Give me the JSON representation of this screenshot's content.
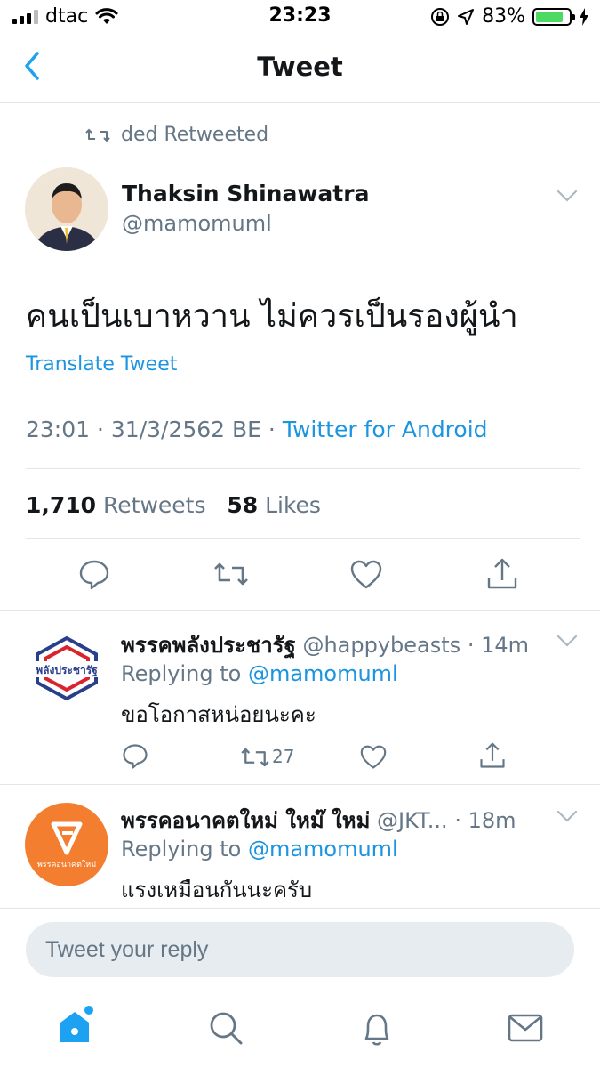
{
  "status_bar": {
    "carrier": "dtac",
    "time": "23:23",
    "battery": "83%",
    "battery_level": 0.83
  },
  "nav": {
    "title": "Tweet",
    "back_icon": "chevron-left-icon"
  },
  "tweet": {
    "retweeted_by": "ded Retweeted",
    "author_name": "Thaksin Shinawatra",
    "author_handle": "@mamomuml",
    "text": "คนเป็นเบาหวาน ไม่ควรเป็นรองผู้นำ",
    "translate_label": "Translate Tweet",
    "timestamp": "23:01 · 31/3/2562 BE · ",
    "source": "Twitter for Android",
    "retweet_count": "1,710",
    "retweet_label": "Retweets",
    "like_count": "58",
    "like_label": "Likes"
  },
  "replies": [
    {
      "name": "พรรคพลังประชารัฐ",
      "handle": "@happybeasts · 14m",
      "replying_prefix": "Replying to ",
      "replying_to": "@mamomuml",
      "text": "ขอโอกาสหน่อยนะคะ",
      "retweet_count": "27",
      "avatar_text": "พลังประชารัฐ",
      "avatar_color": "#ffffff"
    },
    {
      "name": "พรรคอนาคตใหม่ ใหม๊ ใหม่",
      "handle": "@JKT... · 18m",
      "replying_prefix": "Replying to ",
      "replying_to": "@mamomuml",
      "text": "แรงเหมือนกันนะครับ",
      "avatar_text": "พรรคอนาคตใหม่",
      "avatar_color": "#f47e30"
    }
  ],
  "composer": {
    "placeholder": "Tweet your reply"
  },
  "colors": {
    "accent": "#1da1f2",
    "link": "#1b95e0",
    "muted": "#657786"
  }
}
